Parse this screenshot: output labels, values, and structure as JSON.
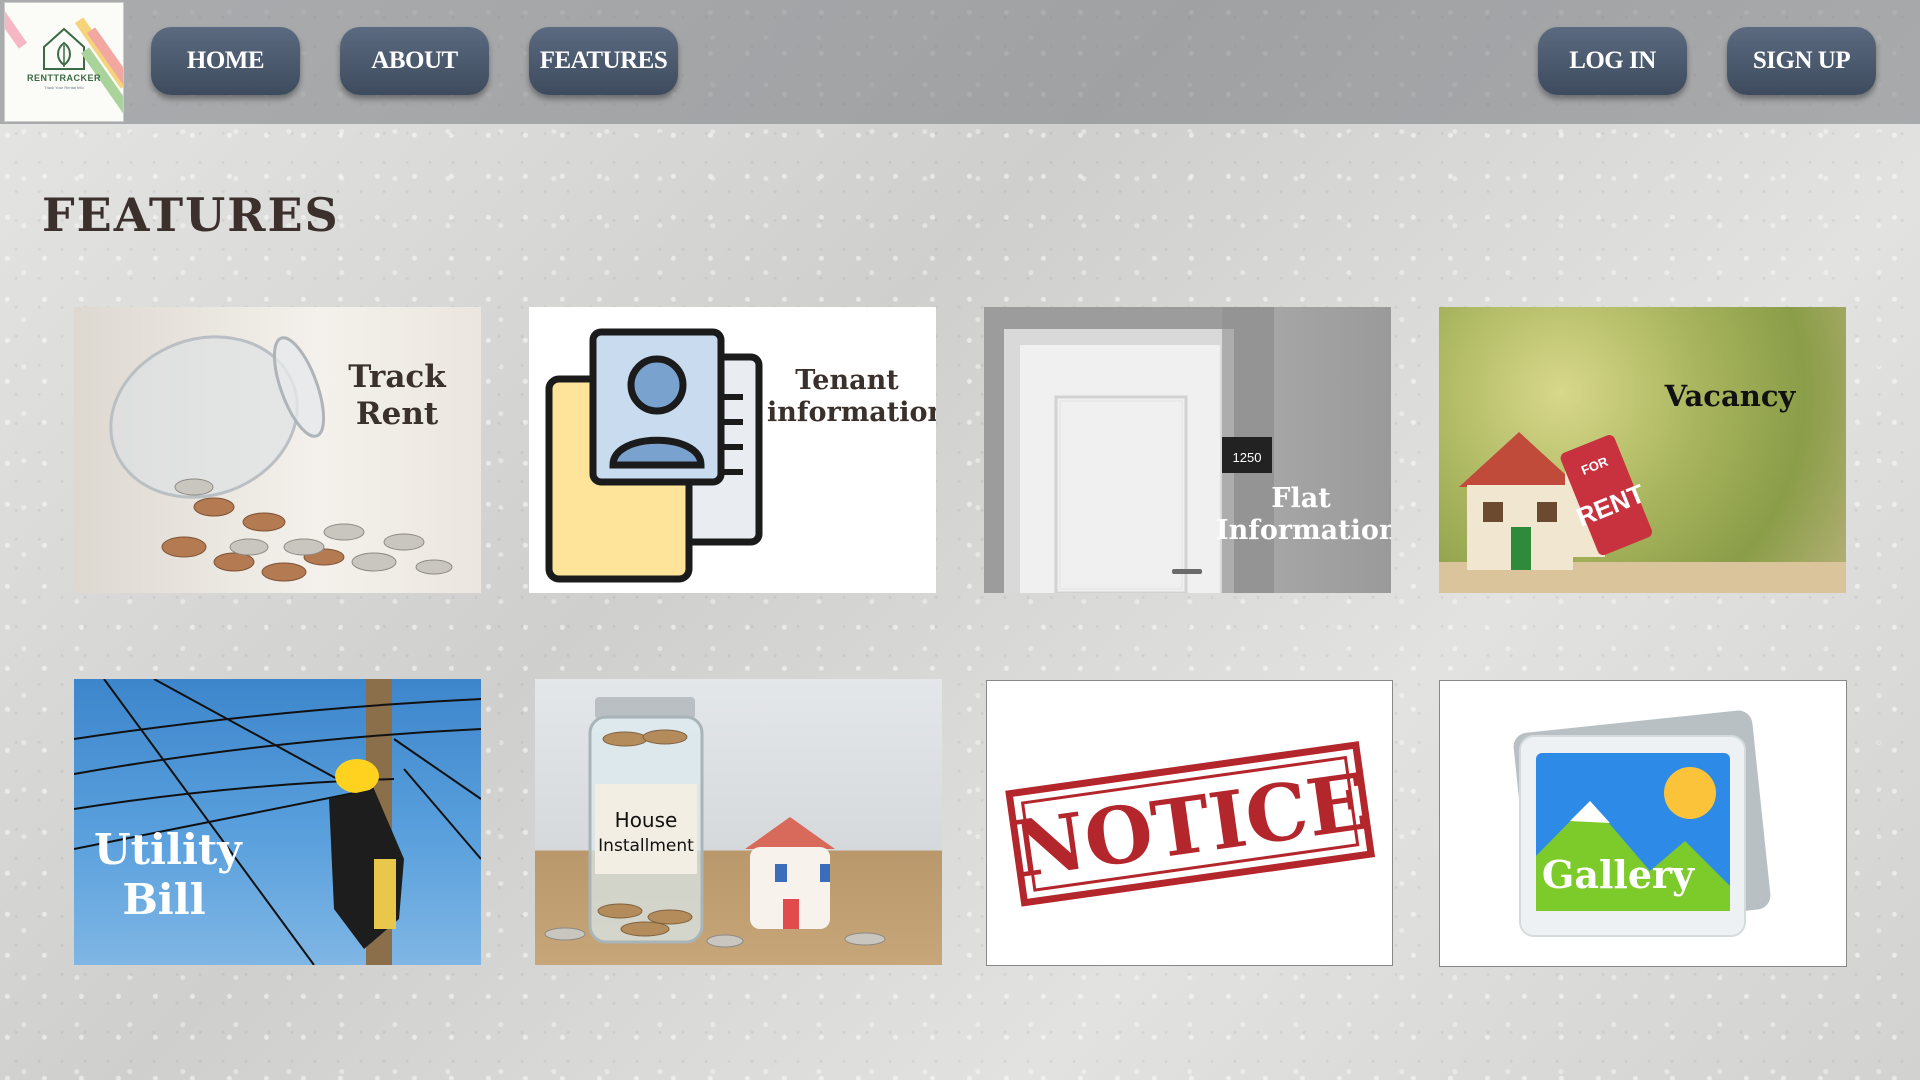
{
  "logo": {
    "brand": "RENTTRACKER",
    "tagline": "Track Your Rental Info"
  },
  "nav": {
    "home": "HOME",
    "about": "ABOUT",
    "features": "FEATURES",
    "login": "LOG IN",
    "signup": "SIGN UP"
  },
  "page_title": "FEATURES",
  "cards": [
    {
      "line1": "Track",
      "line2": "Rent",
      "icon": "coin-jar-icon"
    },
    {
      "line1": "Tenant",
      "line2": "information",
      "icon": "tenant-profile-icon"
    },
    {
      "line1": "Flat",
      "line2": "Information",
      "room_number": "1250",
      "icon": "door-icon"
    },
    {
      "label": "Vacancy",
      "sign_top": "FOR",
      "sign_bottom": "RENT",
      "icon": "house-for-rent-icon"
    },
    {
      "line1": "Utility",
      "line2": "Bill",
      "icon": "power-line-worker-icon"
    },
    {
      "line1": "House",
      "line2": "Installment",
      "icon": "savings-jar-house-icon"
    },
    {
      "label": "NOTICE",
      "icon": "notice-stamp-icon"
    },
    {
      "label": "Gallery",
      "icon": "gallery-image-icon"
    }
  ],
  "colors": {
    "nav_button": "#4a586c",
    "title": "#3b302c",
    "notice_red": "#b3262c"
  }
}
